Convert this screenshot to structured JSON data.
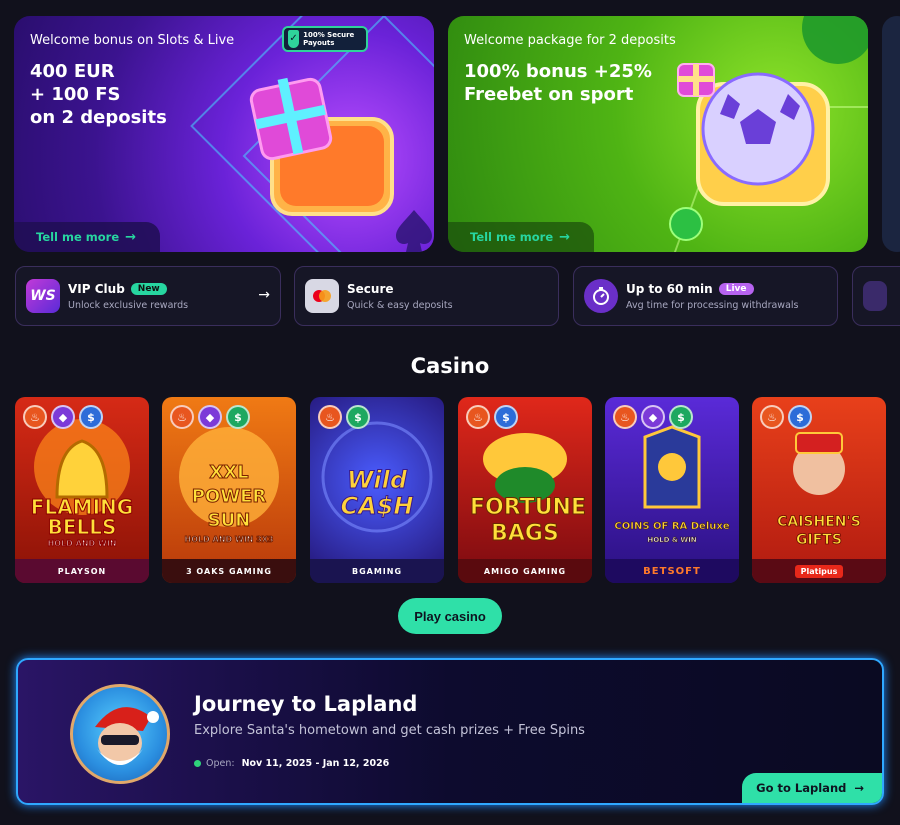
{
  "promos": [
    {
      "subtitle": "Welcome bonus on Slots & Live",
      "title_lines": [
        "400 EUR",
        "+ 100 FS",
        "on 2 deposits"
      ],
      "cta": "Tell me more",
      "badge": "100% Secure Payouts"
    },
    {
      "subtitle": "Welcome package for 2 deposits",
      "title_lines": [
        "100% bonus +25%",
        "Freebet on sport"
      ],
      "cta": "Tell me more"
    }
  ],
  "features": [
    {
      "title": "VIP Club",
      "tag": "New",
      "desc": "Unlock exclusive rewards",
      "icon": "vip-ws-icon"
    },
    {
      "title": "Secure",
      "desc": "Quick & easy deposits",
      "icon": "mastercard-wallet-icon"
    },
    {
      "title": "Up to 60 min",
      "tag": "Live",
      "desc": "Avg time for processing withdrawals",
      "icon": "stopwatch-icon"
    }
  ],
  "casino": {
    "title": "Casino",
    "play_label": "Play casino",
    "games": [
      {
        "logo": "FLAMING BELLS",
        "logo_sub": "HOLD AND WIN",
        "provider": "PLAYSON",
        "badges": [
          "fire",
          "gem",
          "cycle"
        ]
      },
      {
        "logo": "XXL POWER SUN",
        "logo_sub": "HOLD AND WIN 3X3",
        "provider": "3 OAKS GAMING",
        "badges": [
          "fire",
          "gem",
          "money"
        ]
      },
      {
        "logo": "Wild CA$H",
        "logo_sub": "",
        "provider": "BGAMING",
        "badges": [
          "fire",
          "money"
        ]
      },
      {
        "logo": "FORTUNE BAGS",
        "logo_sub": "",
        "provider": "AMIGO GAMING",
        "badges": [
          "fire",
          "cycle"
        ]
      },
      {
        "logo": "COINS OF RA Deluxe",
        "logo_sub": "HOLD & WIN",
        "provider": "BETSOFT",
        "badges": [
          "fire",
          "gem",
          "money"
        ]
      },
      {
        "logo": "CAISHEN'S GIFTS",
        "logo_sub": "",
        "provider": "Platipus",
        "badges": [
          "fire",
          "cycle"
        ]
      }
    ]
  },
  "lapland": {
    "title": "Journey to Lapland",
    "desc": "Explore Santa's hometown and get cash prizes + Free Spins",
    "status": "Open:",
    "dates": "Nov 11, 2025 - Jan 12, 2026",
    "cta": "Go to Lapland"
  },
  "colors": {
    "accent": "#2fe0a8",
    "background": "#11111c",
    "live_tag": "#b763f0"
  }
}
